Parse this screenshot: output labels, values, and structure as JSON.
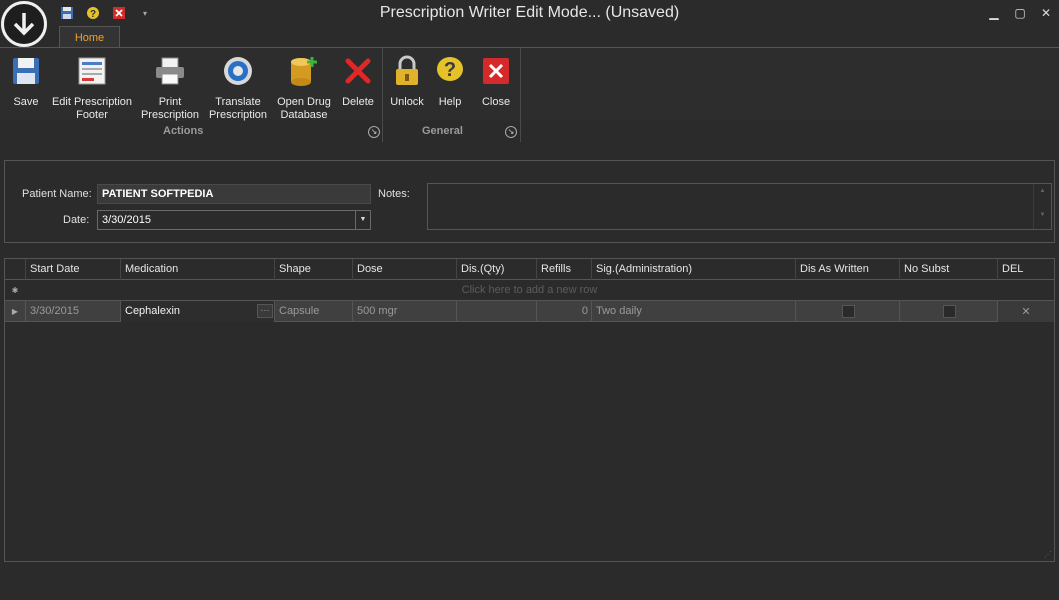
{
  "window": {
    "title": "Prescription Writer Edit Mode... (Unsaved)"
  },
  "ribbon": {
    "tab": "Home",
    "actions": {
      "label": "Actions",
      "buttons": [
        {
          "label": "Save"
        },
        {
          "label": "Edit Prescription Footer"
        },
        {
          "label": "Print Prescription"
        },
        {
          "label": "Translate Prescription"
        },
        {
          "label": "Open Drug Database"
        },
        {
          "label": "Delete"
        }
      ]
    },
    "general": {
      "label": "General",
      "buttons": [
        {
          "label": "Unlock"
        },
        {
          "label": "Help"
        },
        {
          "label": "Close"
        }
      ]
    }
  },
  "patient": {
    "name_label": "Patient Name:",
    "name_value": "PATIENT SOFTPEDIA",
    "date_label": "Date:",
    "date_value": "3/30/2015",
    "notes_label": "Notes:",
    "notes_value": ""
  },
  "grid": {
    "columns": [
      "Start Date",
      "Medication",
      "Shape",
      "Dose",
      "Dis.(Qty)",
      "Refills",
      "Sig.(Administration)",
      "Dis As Written",
      "No Subst",
      "DEL"
    ],
    "new_row_hint": "Click here to add a new row",
    "rows": [
      {
        "start_date": "3/30/2015",
        "medication": "Cephalexin",
        "shape": "Capsule",
        "dose": "500 mgr",
        "qty": "",
        "refills": "0",
        "sig": "Two daily",
        "dis_as_written": false,
        "no_subst": false
      }
    ]
  },
  "colors": {
    "accent": "#f0a030",
    "background": "#2b2b2b"
  }
}
